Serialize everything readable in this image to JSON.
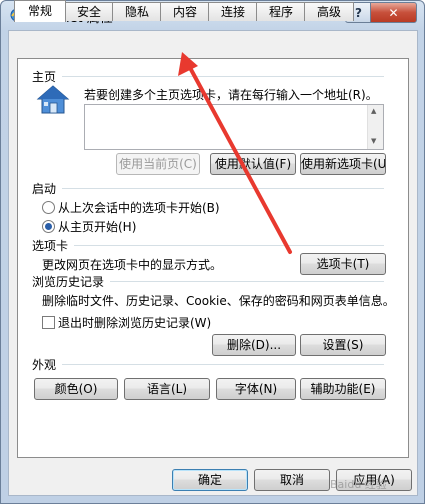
{
  "window": {
    "title": "Internet 属性"
  },
  "tabs": [
    "常规",
    "安全",
    "隐私",
    "内容",
    "连接",
    "程序",
    "高级"
  ],
  "home_page": {
    "section_label": "主页",
    "description": "若要创建多个主页选项卡，请在每行输入一个地址(R)。",
    "url_value": "",
    "use_current_label": "使用当前页(C)",
    "use_default_label": "使用默认值(F)",
    "use_new_tab_label": "使用新选项卡(U)"
  },
  "startup": {
    "section_label": "启动",
    "option_last_session": "从上次会话中的选项卡开始(B)",
    "option_home_page": "从主页开始(H)",
    "selected": "option_home_page"
  },
  "tabs_section": {
    "section_label": "选项卡",
    "description": "更改网页在选项卡中的显示方式。",
    "tabs_button_label": "选项卡(T)"
  },
  "browsing_history": {
    "section_label": "浏览历史记录",
    "description": "删除临时文件、历史记录、Cookie、保存的密码和网页表单信息。",
    "delete_on_exit_label": "退出时删除浏览历史记录(W)",
    "delete_on_exit_checked": false,
    "delete_button_label": "删除(D)...",
    "settings_button_label": "设置(S)"
  },
  "appearance": {
    "section_label": "外观",
    "colors_label": "颜色(O)",
    "languages_label": "语言(L)",
    "fonts_label": "字体(N)",
    "accessibility_label": "辅助功能(E)"
  },
  "footer": {
    "ok_label": "确定",
    "cancel_label": "取消",
    "apply_label": "应用(A)"
  },
  "annotation": {
    "color": "#e8392f"
  },
  "watermark_text": "Baidu 经验"
}
